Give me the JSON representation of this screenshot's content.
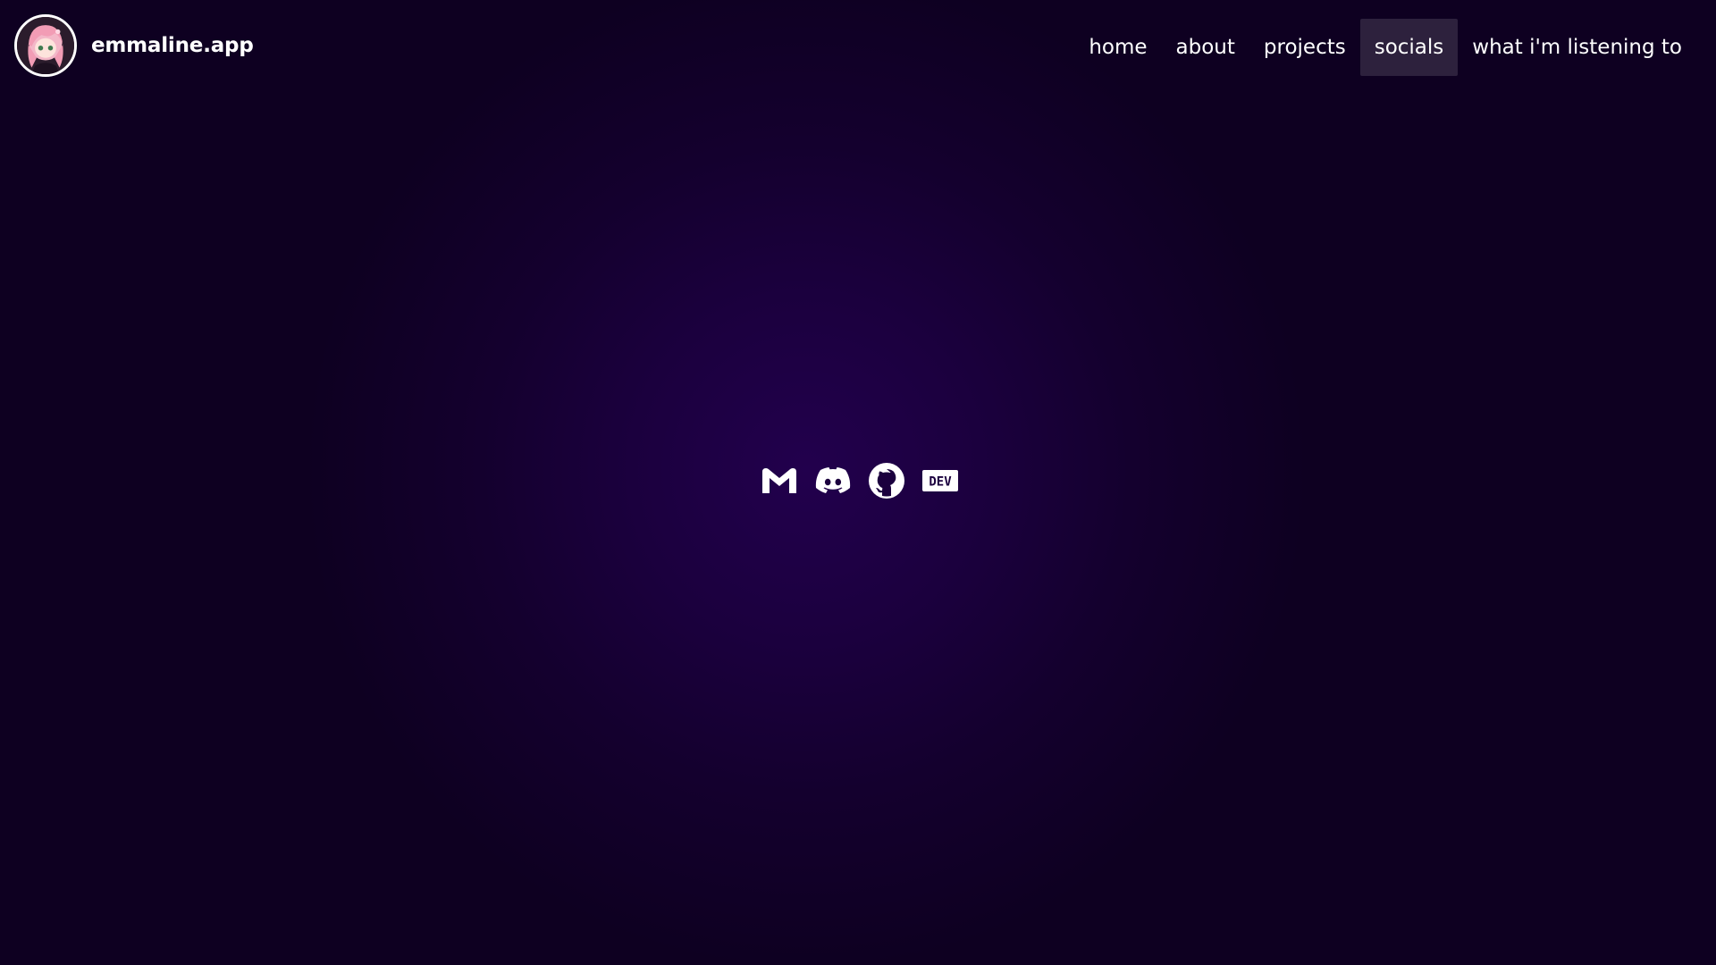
{
  "site": {
    "brand_name": "emmaline.app",
    "avatar_icon": "anime-girl-avatar"
  },
  "nav": {
    "items": [
      {
        "label": "home",
        "active": false
      },
      {
        "label": "about",
        "active": false
      },
      {
        "label": "projects",
        "active": false
      },
      {
        "label": "socials",
        "active": true
      },
      {
        "label": "what i'm listening to",
        "active": false
      }
    ]
  },
  "socials": {
    "links": [
      {
        "icon": "gmail-icon"
      },
      {
        "icon": "discord-icon"
      },
      {
        "icon": "github-icon"
      },
      {
        "icon": "dev-icon",
        "label": "DEV"
      }
    ]
  },
  "colors": {
    "background_center": "#22004d",
    "background_edge": "#0e0021",
    "text": "#ffffff",
    "active_nav_bg": "rgba(255,255,255,0.13)"
  }
}
